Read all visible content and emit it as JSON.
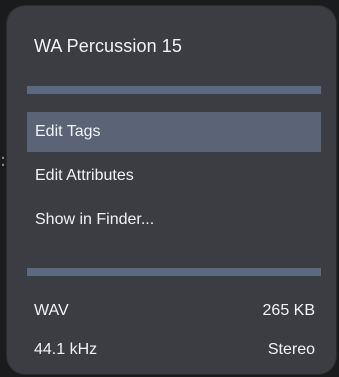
{
  "popup": {
    "title": "WA Percussion 15"
  },
  "menu": {
    "items": [
      {
        "label": "Edit Tags",
        "selected": true
      },
      {
        "label": "Edit Attributes",
        "selected": false
      },
      {
        "label": "Show in Finder...",
        "selected": false
      }
    ]
  },
  "file_info": {
    "format": "WAV",
    "size": "265 KB",
    "sample_rate": "44.1 kHz",
    "channels": "Stereo"
  },
  "colors": {
    "popup_background": "#3b3d42",
    "separator": "#5b6a80",
    "selected_item": "#5a6476",
    "text": "#f2f3f5"
  }
}
